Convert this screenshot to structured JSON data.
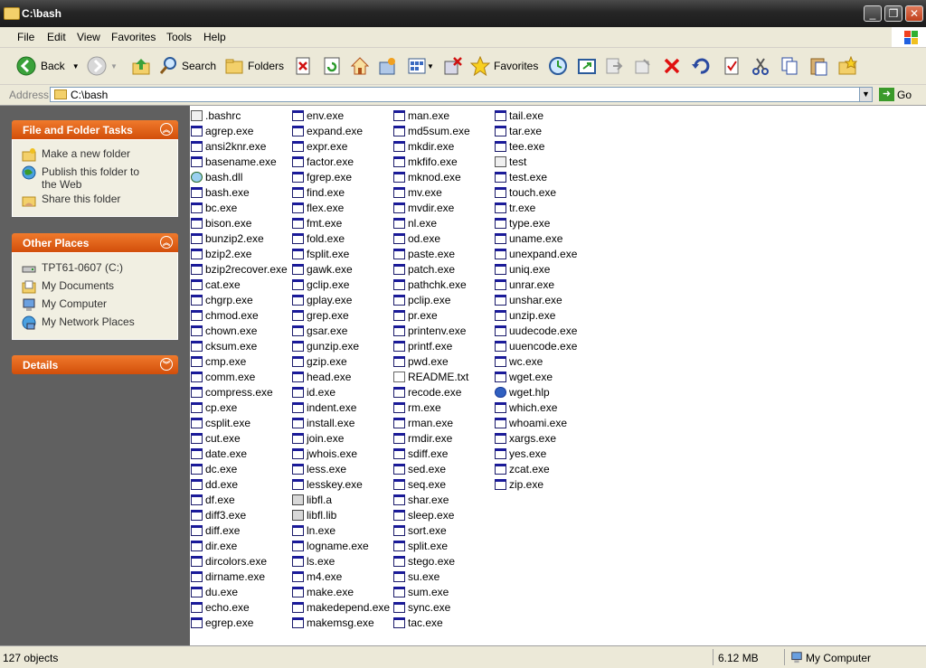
{
  "window": {
    "title": "C:\\bash"
  },
  "menu": [
    "File",
    "Edit",
    "View",
    "Favorites",
    "Tools",
    "Help"
  ],
  "toolbar": {
    "back_label": "Back",
    "search_label": "Search",
    "folders_label": "Folders",
    "favorites_label": "Favorites"
  },
  "address": {
    "label": "Address",
    "value": "C:\\bash",
    "go_label": "Go"
  },
  "sidebar": {
    "file_tasks": {
      "title": "File and Folder Tasks",
      "items": [
        {
          "label": "Make a new folder",
          "icon": "new-folder-icon"
        },
        {
          "label": "Publish this folder to the Web",
          "icon": "publish-web-icon"
        },
        {
          "label": "Share this folder",
          "icon": "share-folder-icon"
        }
      ]
    },
    "other_places": {
      "title": "Other Places",
      "items": [
        {
          "label": "TPT61-0607 (C:)",
          "icon": "drive-icon"
        },
        {
          "label": "My Documents",
          "icon": "my-documents-icon"
        },
        {
          "label": "My Computer",
          "icon": "my-computer-icon"
        },
        {
          "label": "My Network Places",
          "icon": "network-places-icon"
        }
      ]
    },
    "details": {
      "title": "Details"
    }
  },
  "files": [
    [
      ".bashrc",
      "agrep.exe",
      "ansi2knr.exe",
      "basename.exe",
      "bash.dll",
      "bash.exe",
      "bc.exe",
      "bison.exe",
      "bunzip2.exe",
      "bzip2.exe",
      "bzip2recover.exe",
      "cat.exe",
      "chgrp.exe",
      "chmod.exe",
      "chown.exe",
      "cksum.exe",
      "cmp.exe",
      "comm.exe",
      "compress.exe",
      "cp.exe",
      "csplit.exe",
      "cut.exe",
      "date.exe",
      "dc.exe",
      "dd.exe",
      "df.exe",
      "diff3.exe",
      "diff.exe",
      "dir.exe",
      "dircolors.exe",
      "dirname.exe",
      "du.exe",
      "echo.exe",
      "egrep.exe"
    ],
    [
      "env.exe",
      "expand.exe",
      "expr.exe",
      "factor.exe",
      "fgrep.exe",
      "find.exe",
      "flex.exe",
      "fmt.exe",
      "fold.exe",
      "fsplit.exe",
      "gawk.exe",
      "gclip.exe",
      "gplay.exe",
      "grep.exe",
      "gsar.exe",
      "gunzip.exe",
      "gzip.exe",
      "head.exe",
      "id.exe",
      "indent.exe",
      "install.exe",
      "join.exe",
      "jwhois.exe",
      "less.exe",
      "lesskey.exe",
      "libfl.a",
      "libfl.lib",
      "ln.exe",
      "logname.exe",
      "ls.exe",
      "m4.exe",
      "make.exe",
      "makedepend.exe",
      "makemsg.exe"
    ],
    [
      "man.exe",
      "md5sum.exe",
      "mkdir.exe",
      "mkfifo.exe",
      "mknod.exe",
      "mv.exe",
      "mvdir.exe",
      "nl.exe",
      "od.exe",
      "paste.exe",
      "patch.exe",
      "pathchk.exe",
      "pclip.exe",
      "pr.exe",
      "printenv.exe",
      "printf.exe",
      "pwd.exe",
      "README.txt",
      "recode.exe",
      "rm.exe",
      "rman.exe",
      "rmdir.exe",
      "sdiff.exe",
      "sed.exe",
      "seq.exe",
      "shar.exe",
      "sleep.exe",
      "sort.exe",
      "split.exe",
      "stego.exe",
      "su.exe",
      "sum.exe",
      "sync.exe",
      "tac.exe"
    ],
    [
      "tail.exe",
      "tar.exe",
      "tee.exe",
      "test",
      "test.exe",
      "touch.exe",
      "tr.exe",
      "type.exe",
      "uname.exe",
      "unexpand.exe",
      "uniq.exe",
      "unrar.exe",
      "unshar.exe",
      "unzip.exe",
      "uudecode.exe",
      "uuencode.exe",
      "wc.exe",
      "wget.exe",
      "wget.hlp",
      "which.exe",
      "whoami.exe",
      "xargs.exe",
      "yes.exe",
      "zcat.exe",
      "zip.exe"
    ]
  ],
  "status": {
    "objects": "127 objects",
    "size": "6.12 MB",
    "location": "My Computer"
  }
}
